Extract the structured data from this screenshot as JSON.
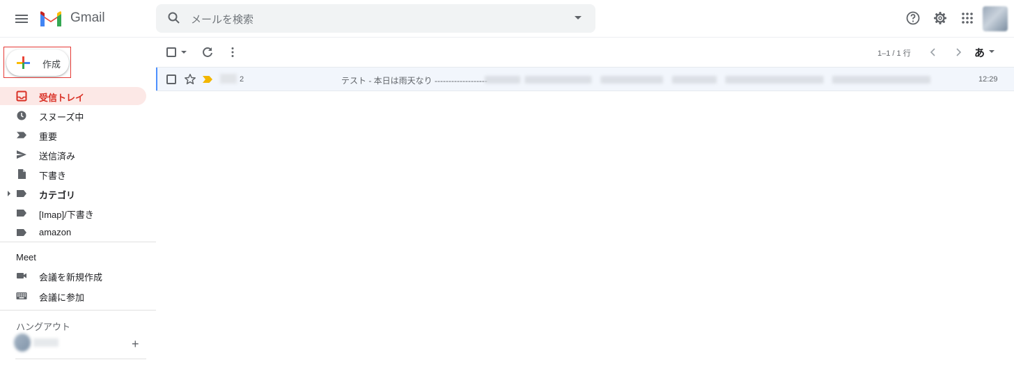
{
  "header": {
    "app_name": "Gmail",
    "search_placeholder": "メールを検索"
  },
  "sidebar": {
    "compose_label": "作成",
    "items": [
      {
        "label": "受信トレイ",
        "icon": "inbox-icon"
      },
      {
        "label": "スヌーズ中",
        "icon": "clock-icon"
      },
      {
        "label": "重要",
        "icon": "important-icon"
      },
      {
        "label": "送信済み",
        "icon": "send-icon"
      },
      {
        "label": "下書き",
        "icon": "draft-icon"
      },
      {
        "label": "カテゴリ",
        "icon": "label-icon"
      },
      {
        "label": "[Imap]/下書き",
        "icon": "label-icon"
      },
      {
        "label": "amazon",
        "icon": "label-icon"
      }
    ],
    "meet": {
      "title": "Meet",
      "items": [
        {
          "label": "会議を新規作成",
          "icon": "video-icon"
        },
        {
          "label": "会議に参加",
          "icon": "keyboard-icon"
        }
      ]
    },
    "hangouts": {
      "title": "ハングアウト"
    }
  },
  "toolbar": {
    "pager_text": "1–1 / 1 行",
    "input_tool_label": "あ"
  },
  "messages": [
    {
      "count": "2",
      "subject": "テスト - 本日は雨天なり -------------------",
      "time": "12:29"
    }
  ],
  "colors": {
    "accent_red": "#d93025",
    "active_bg": "#fce8e6",
    "important_marker": "#f2b600"
  }
}
